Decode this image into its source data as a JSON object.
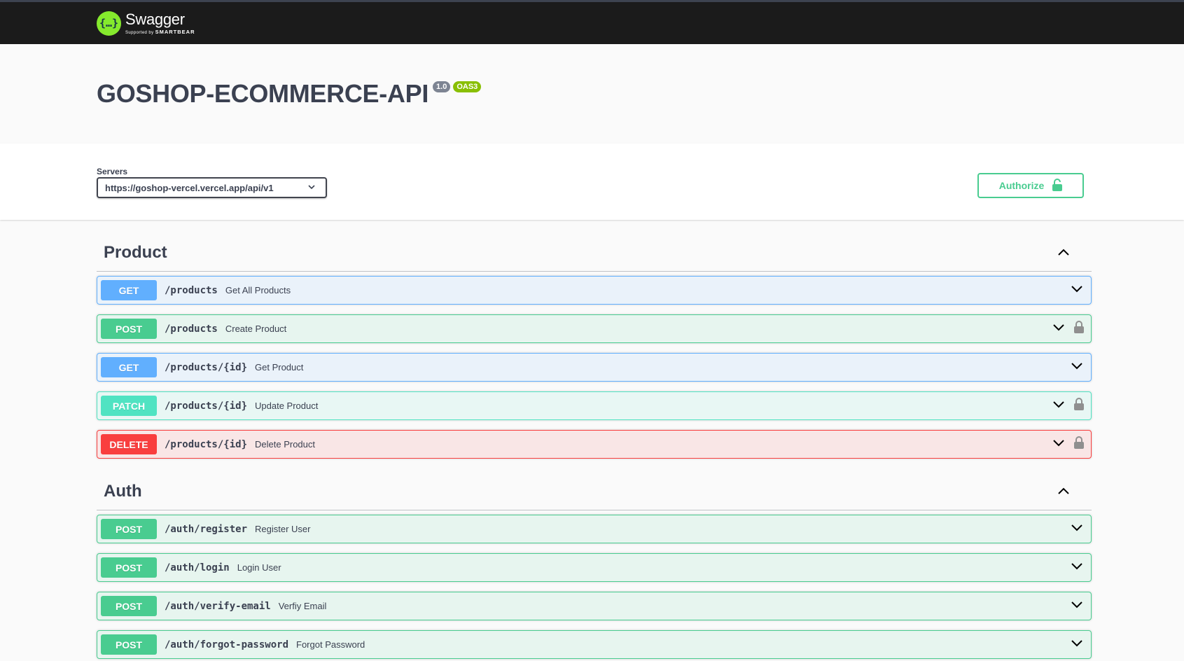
{
  "topbar": {
    "logo_glyph": "{…}",
    "logo_name": "Swagger",
    "logo_sub_prefix": "Supported by",
    "logo_sub_brand": "SMARTBEAR"
  },
  "info": {
    "title": "GOSHOP-ECOMMERCE-API",
    "version": "1.0",
    "oas": "OAS3"
  },
  "scheme": {
    "servers_label": "Servers",
    "server_value": "https://goshop-vercel.vercel.app/api/v1",
    "authorize_label": "Authorize"
  },
  "tags": [
    {
      "name": "Product",
      "operations": [
        {
          "method": "GET",
          "path": "/products",
          "summary": "Get All Products",
          "locked": false
        },
        {
          "method": "POST",
          "path": "/products",
          "summary": "Create Product",
          "locked": true
        },
        {
          "method": "GET",
          "path": "/products/{id}",
          "summary": "Get Product",
          "locked": false
        },
        {
          "method": "PATCH",
          "path": "/products/{id}",
          "summary": "Update Product",
          "locked": true
        },
        {
          "method": "DELETE",
          "path": "/products/{id}",
          "summary": "Delete Product",
          "locked": true
        }
      ]
    },
    {
      "name": "Auth",
      "operations": [
        {
          "method": "POST",
          "path": "/auth/register",
          "summary": "Register User",
          "locked": false
        },
        {
          "method": "POST",
          "path": "/auth/login",
          "summary": "Login User",
          "locked": false
        },
        {
          "method": "POST",
          "path": "/auth/verify-email",
          "summary": "Verfiy Email",
          "locked": false
        },
        {
          "method": "POST",
          "path": "/auth/forgot-password",
          "summary": "Forgot Password",
          "locked": false
        }
      ]
    }
  ],
  "colors": {
    "get": "#61affe",
    "post": "#49cc90",
    "patch": "#50e3c2",
    "delete": "#f93e3e",
    "topbar": "#1b1b1b",
    "logo": "#85ea2d"
  }
}
